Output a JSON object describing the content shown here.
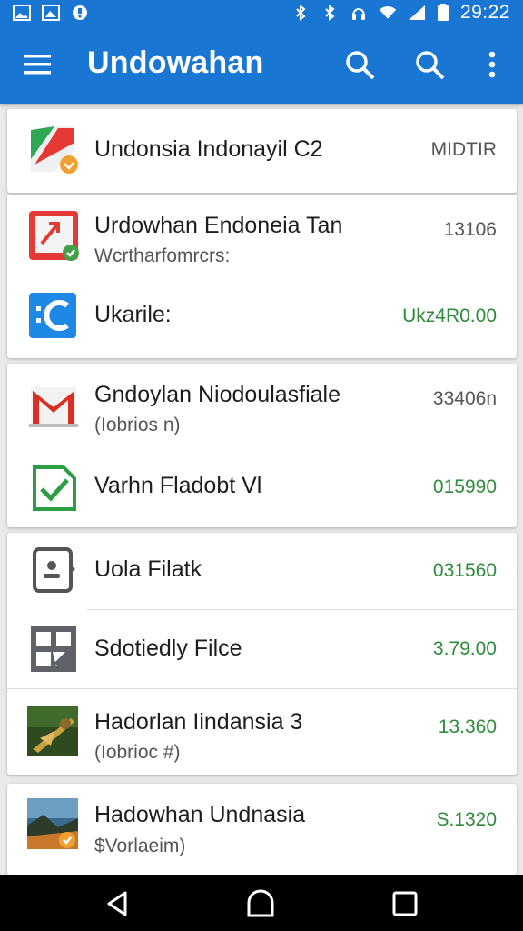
{
  "status_bar": {
    "time": "29:22",
    "icons": [
      "image-icon",
      "photo-icon",
      "notification-icon",
      "bluetooth-icon",
      "bluetooth-icon",
      "headset-icon",
      "wifi-icon",
      "signal-icon",
      "battery-icon"
    ]
  },
  "app_bar": {
    "title": "Undowahan",
    "icons": [
      "menu-icon",
      "search-icon",
      "search-icon",
      "more-vert-icon"
    ]
  },
  "colors": {
    "primary": "#1976d2",
    "green": "#2e8b3a",
    "orange_badge": "#f0a030",
    "green_badge": "#43a047"
  },
  "cards": [
    {
      "rows": [
        {
          "icon": "maps-icon",
          "title": "Undonsia Indonayil C2",
          "subtitle": "",
          "value": "MIDTIR",
          "value_color": "gray"
        }
      ]
    },
    {
      "rows": [
        {
          "icon": "pdf-icon",
          "title": "Urdowhan Endoneia Tan",
          "subtitle": "Wcrtharfomrcrs:",
          "value": "13106",
          "value_color": "gray"
        },
        {
          "icon": "c-app-icon",
          "title": "Ukarile:",
          "subtitle": "",
          "value": "Ukz4R0.00",
          "value_color": "green"
        }
      ]
    },
    {
      "rows": [
        {
          "icon": "gmail-icon",
          "title": "Gndoylan Niodoulasfiale",
          "subtitle": "(Iobrios n)",
          "value": "33406n",
          "value_color": "gray"
        },
        {
          "icon": "check-doc-icon",
          "title": "Varhn Fladobt Vl",
          "subtitle": "",
          "value": "015990",
          "value_color": "green"
        }
      ]
    },
    {
      "rows": [
        {
          "icon": "contact-doc-icon",
          "title": "Uola Filatk",
          "subtitle": "",
          "value": "031560",
          "value_color": "green"
        },
        {
          "icon": "image-grid-icon",
          "title": "Sdotiedly Filce",
          "subtitle": "",
          "value": "3.79.00",
          "value_color": "green"
        },
        {
          "icon": "photo-thumbnail-icon",
          "title": "Hadorlan Iindansia 3",
          "subtitle": "(Iobrioc #)",
          "value": "13.360",
          "value_color": "green"
        }
      ]
    },
    {
      "rows": [
        {
          "icon": "landscape-thumbnail-icon",
          "title": "Hadowhan Undnasia",
          "subtitle": "$Vorlaeim)",
          "value": "S.1320",
          "value_color": "green"
        }
      ]
    }
  ],
  "nav_bar": {
    "icons": [
      "back-icon",
      "home-icon",
      "recents-icon"
    ]
  }
}
